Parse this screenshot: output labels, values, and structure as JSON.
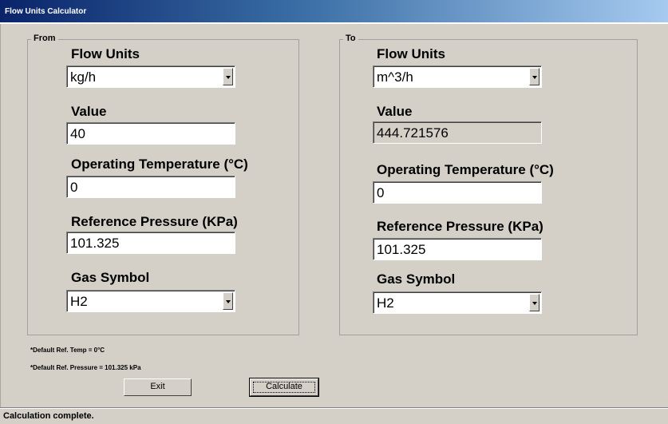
{
  "window": {
    "title": "Flow Units Calculator"
  },
  "from_group": {
    "legend": "From",
    "flow_units_label": "Flow Units",
    "flow_units_value": "kg/h",
    "value_label": "Value",
    "value": "40",
    "temp_label": "Operating Temperature (°C)",
    "temp_value": "0",
    "pressure_label": "Reference Pressure (KPa)",
    "pressure_value": "101.325",
    "gas_label": "Gas Symbol",
    "gas_value": "H2"
  },
  "to_group": {
    "legend": "To",
    "flow_units_label": "Flow Units",
    "flow_units_value": "m^3/h",
    "value_label": "Value",
    "value": "444.721576",
    "temp_label": "Operating Temperature (°C)",
    "temp_value": "0",
    "pressure_label": "Reference Pressure (KPa)",
    "pressure_value": "101.325",
    "gas_label": "Gas Symbol",
    "gas_value": "H2"
  },
  "notes": {
    "default_temp": "*Default Ref. Temp = 0°C",
    "default_pressure": "*Default Ref. Pressure = 101.325 kPa"
  },
  "buttons": {
    "exit": "Exit",
    "calculate": "Calculate"
  },
  "status": {
    "text": "Calculation complete."
  }
}
